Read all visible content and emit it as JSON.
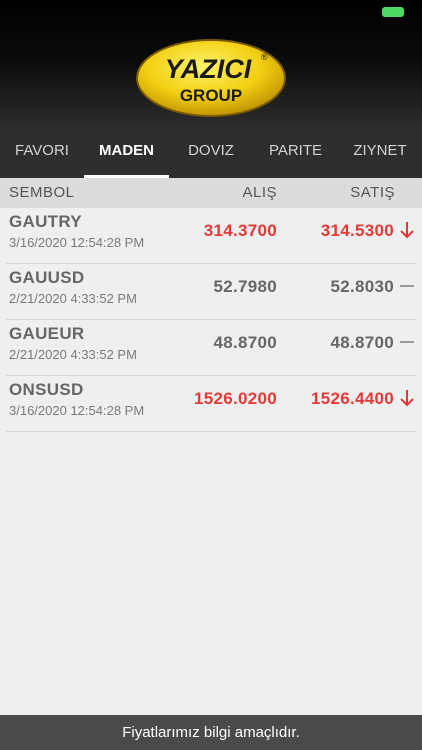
{
  "brand": {
    "name": "YAZICI",
    "sub": "GROUP",
    "mark": "®"
  },
  "tabs": [
    {
      "label": "FAVORI",
      "active": false
    },
    {
      "label": "MADEN",
      "active": true
    },
    {
      "label": "DOVIZ",
      "active": false
    },
    {
      "label": "PARITE",
      "active": false
    },
    {
      "label": "ZIYNET",
      "active": false
    }
  ],
  "columns": {
    "symbol": "SEMBOL",
    "buy": "ALIŞ",
    "sell": "SATIŞ"
  },
  "rows": [
    {
      "symbol": "GAUTRY",
      "time": "3/16/2020 12:54:28 PM",
      "buy": "314.3700",
      "sell": "314.5300",
      "trend": "down"
    },
    {
      "symbol": "GAUUSD",
      "time": "2/21/2020 4:33:52 PM",
      "buy": "52.7980",
      "sell": "52.8030",
      "trend": "flat"
    },
    {
      "symbol": "GAUEUR",
      "time": "2/21/2020 4:33:52 PM",
      "buy": "48.8700",
      "sell": "48.8700",
      "trend": "flat"
    },
    {
      "symbol": "ONSUSD",
      "time": "3/16/2020 12:54:28 PM",
      "buy": "1526.0200",
      "sell": "1526.4400",
      "trend": "down"
    }
  ],
  "footer": {
    "text": "Fiyatlarımız bilgi amaçlıdır."
  },
  "colors": {
    "down": "#e53935",
    "flat": "#666666",
    "battery": "#4cd964"
  }
}
